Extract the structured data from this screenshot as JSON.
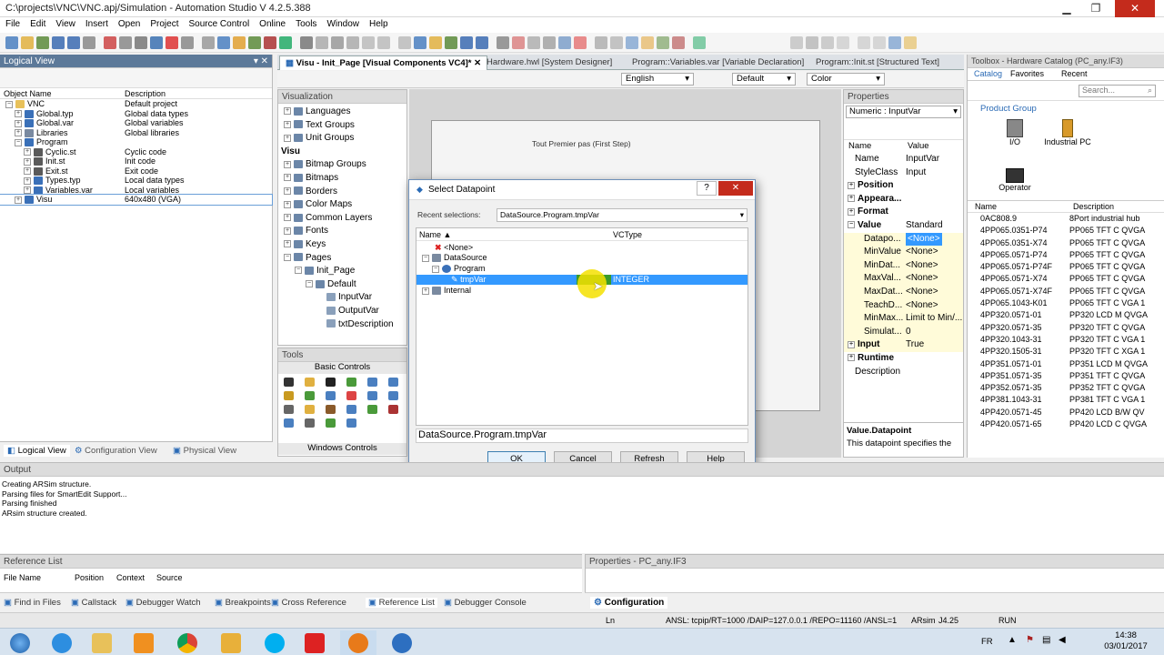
{
  "window": {
    "title": "C:\\projects\\VNC\\VNC.apj/Simulation - Automation Studio V 4.2.5.388"
  },
  "menu": [
    "File",
    "Edit",
    "View",
    "Insert",
    "Open",
    "Project",
    "Source Control",
    "Online",
    "Tools",
    "Window",
    "Help"
  ],
  "logical_view": {
    "title": "Logical View",
    "col_name": "Object Name",
    "col_desc": "Description",
    "rows": [
      {
        "name": "VNC",
        "desc": "Default project"
      },
      {
        "name": "Global.typ",
        "desc": "Global data types"
      },
      {
        "name": "Global.var",
        "desc": "Global variables"
      },
      {
        "name": "Libraries",
        "desc": "Global libraries"
      },
      {
        "name": "Program",
        "desc": ""
      },
      {
        "name": "Cyclic.st",
        "desc": "Cyclic code"
      },
      {
        "name": "Init.st",
        "desc": "Init code"
      },
      {
        "name": "Exit.st",
        "desc": "Exit code"
      },
      {
        "name": "Types.typ",
        "desc": "Local data types"
      },
      {
        "name": "Variables.var",
        "desc": "Local variables"
      },
      {
        "name": "Visu",
        "desc": "640x480 (VGA)"
      }
    ],
    "tabs": [
      "Logical View",
      "Configuration View",
      "Physical View"
    ]
  },
  "doc_tabs": [
    "Visu - Init_Page [Visual Components VC4]*",
    "Hardware.hwl [System Designer]",
    "Program::Variables.var [Variable Declaration]",
    "Program::Init.st [Structured Text]"
  ],
  "editor_toolbar": {
    "language": "English",
    "layer": "Default",
    "color": "Color"
  },
  "visualization": {
    "title": "Visualization",
    "items": [
      "Languages",
      "Text Groups",
      "Unit Groups",
      "Visu",
      "Bitmap Groups",
      "Bitmaps",
      "Borders",
      "Color Maps",
      "Common Layers",
      "Fonts",
      "Keys",
      "Pages",
      "Init_Page",
      "Default",
      "InputVar",
      "OutputVar",
      "txtDescription"
    ]
  },
  "tools": {
    "title": "Tools",
    "group": "Basic Controls",
    "footer": "Windows Controls"
  },
  "canvas": {
    "text": "Tout Premier pas (First Step)"
  },
  "dialog": {
    "title": "Select Datapoint",
    "recent_label": "Recent selections:",
    "recent_value": "DataSource.Program.tmpVar",
    "col_name": "Name",
    "col_type": "VCType",
    "rows": [
      {
        "name": "<None>",
        "type": ""
      },
      {
        "name": "DataSource",
        "type": ""
      },
      {
        "name": "Program",
        "type": ""
      },
      {
        "name": "tmpVar",
        "type": "INTEGER"
      },
      {
        "name": "Internal",
        "type": ""
      }
    ],
    "path": "DataSource.Program.tmpVar",
    "ok": "OK",
    "cancel": "Cancel",
    "refresh": "Refresh",
    "help": "Help",
    "help_btn": "?",
    "close_btn": "✕"
  },
  "properties": {
    "title": "Properties",
    "selector": "Numeric : InputVar",
    "col_name": "Name",
    "col_value": "Value",
    "rows": [
      {
        "k": "Name",
        "v": "InputVar",
        "bold": false
      },
      {
        "k": "StyleClass",
        "v": "Input",
        "bold": false
      },
      {
        "k": "Position",
        "v": "",
        "bold": true
      },
      {
        "k": "Appeara...",
        "v": "",
        "bold": true
      },
      {
        "k": "Format",
        "v": "",
        "bold": true
      },
      {
        "k": "Value",
        "v": "Standard",
        "bold": true
      },
      {
        "k": "Datapo...",
        "v": "<None>",
        "bold": false
      },
      {
        "k": "MinValue",
        "v": "<None>",
        "bold": false
      },
      {
        "k": "MinDat...",
        "v": "<None>",
        "bold": false
      },
      {
        "k": "MaxVal...",
        "v": "<None>",
        "bold": false
      },
      {
        "k": "MaxDat...",
        "v": "<None>",
        "bold": false
      },
      {
        "k": "TeachD...",
        "v": "<None>",
        "bold": false
      },
      {
        "k": "MinMax...",
        "v": "Limit to Min/...",
        "bold": false
      },
      {
        "k": "Simulat...",
        "v": "0",
        "bold": false
      },
      {
        "k": "Input",
        "v": "True",
        "bold": true
      },
      {
        "k": "Runtime",
        "v": "",
        "bold": true
      },
      {
        "k": "Description",
        "v": "",
        "bold": false
      }
    ],
    "help_title": "Value.Datapoint",
    "help_text": "This datapoint specifies the"
  },
  "toolbox": {
    "title": "Toolbox - Hardware Catalog (PC_any.IF3)",
    "tabs": [
      "Catalog",
      "Favorites",
      "Recent"
    ],
    "search": "Search...",
    "group": "Product Group",
    "items": [
      "I/O",
      "Industrial PC",
      "Operator"
    ],
    "col_name": "Name",
    "col_desc": "Description",
    "rows": [
      {
        "a": "0AC808.9",
        "b": "8Port industrial hub"
      },
      {
        "a": "4PP065.0351-P74",
        "b": "PP065 TFT C QVGA"
      },
      {
        "a": "4PP065.0351-X74",
        "b": "PP065 TFT C QVGA"
      },
      {
        "a": "4PP065.0571-P74",
        "b": "PP065 TFT C QVGA"
      },
      {
        "a": "4PP065.0571-P74F",
        "b": "PP065 TFT C QVGA"
      },
      {
        "a": "4PP065.0571-X74",
        "b": "PP065 TFT C QVGA"
      },
      {
        "a": "4PP065.0571-X74F",
        "b": "PP065 TFT C QVGA"
      },
      {
        "a": "4PP065.1043-K01",
        "b": "PP065 TFT C VGA 1"
      },
      {
        "a": "4PP320.0571-01",
        "b": "PP320 LCD M QVGA"
      },
      {
        "a": "4PP320.0571-35",
        "b": "PP320 TFT C QVGA"
      },
      {
        "a": "4PP320.1043-31",
        "b": "PP320 TFT C VGA 1"
      },
      {
        "a": "4PP320.1505-31",
        "b": "PP320 TFT C XGA 1"
      },
      {
        "a": "4PP351.0571-01",
        "b": "PP351 LCD M QVGA"
      },
      {
        "a": "4PP351.0571-35",
        "b": "PP351 TFT C QVGA"
      },
      {
        "a": "4PP352.0571-35",
        "b": "PP352 TFT C QVGA"
      },
      {
        "a": "4PP381.1043-31",
        "b": "PP381 TFT C VGA 1"
      },
      {
        "a": "4PP420.0571-45",
        "b": "PP420 LCD B/W QV"
      },
      {
        "a": "4PP420.0571-65",
        "b": "PP420 LCD C QVGA"
      }
    ]
  },
  "output": {
    "title": "Output",
    "lines": [
      "Creating ARSim structure.",
      "Parsing files for SmartEdit Support...",
      "Parsing finished",
      "ARsim structure created."
    ]
  },
  "reference_list": {
    "title": "Reference List",
    "cols": [
      "File Name",
      "Position",
      "Context",
      "Source"
    ]
  },
  "props_bottom": {
    "title": "Properties - PC_any.IF3",
    "tab": "Configuration"
  },
  "bottom_tabs": [
    "Find in Files",
    "Callstack",
    "Debugger Watch",
    "Breakpoints",
    "Cross Reference",
    "Reference List",
    "Debugger Console"
  ],
  "statusbar": {
    "ln": "Ln",
    "conn": "ANSL: tcpip/RT=1000 /DAIP=127.0.0.1 /REPO=11160 /ANSL=1",
    "arsim": "ARsim",
    "ver": "J4.25",
    "run": "RUN"
  },
  "taskbar": {
    "lang": "FR",
    "time": "14:38",
    "date": "03/01/2017"
  },
  "colors": {
    "selection": "#3399ff",
    "titlebar_panel": "#5c7999",
    "cursor_highlight": "#f5e000"
  }
}
